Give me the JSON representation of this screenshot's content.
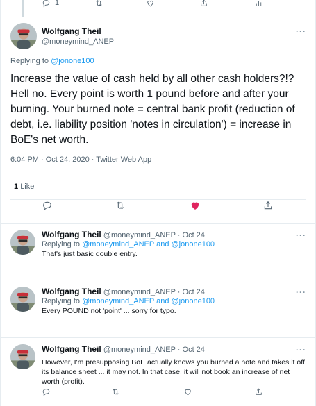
{
  "top_actions": {
    "reply_count": "1"
  },
  "main_tweet": {
    "name": "Wolfgang Theil",
    "handle": "@moneymind_ANEP",
    "replying_prefix": "Replying to",
    "replying_to": "@jonone100",
    "text": "Increase the value of cash held by all other cash holders?!? Hell no.  Every point is worth 1 pound before and after your burning. Your burned note = central bank profit (reduction of debt, i.e. liability position 'notes in circulation') = increase in BoE's net worth.",
    "timestamp": "6:04 PM · Oct 24, 2020 · Twitter Web App",
    "likes_count": "1",
    "likes_label": "Like",
    "liked_color": "#e0245e"
  },
  "replies": [
    {
      "name": "Wolfgang Theil",
      "handle_date": "@moneymind_ANEP · Oct 24",
      "replying_prefix": "Replying to",
      "user1": "@moneymind_ANEP",
      "and": "and",
      "user2": "@jonone100",
      "text": "That's just basic double entry."
    },
    {
      "name": "Wolfgang Theil",
      "handle_date": "@moneymind_ANEP · Oct 24",
      "replying_prefix": "Replying to",
      "user1": "@moneymind_ANEP",
      "and": "and",
      "user2": "@jonone100",
      "text": "Every POUND not 'point' ... sorry for typo."
    },
    {
      "name": "Wolfgang Theil",
      "handle_date": "@moneymind_ANEP · Oct 24",
      "text": "However, I'm presupposing BoE actually knows you burned a note and takes it off its balance sheet ... it may not.  In that case, it will not book an increase of net worth (profit)."
    }
  ],
  "colors": {
    "link": "#1d9bf0",
    "secondary": "#536471",
    "divider": "#e6ecf0"
  }
}
